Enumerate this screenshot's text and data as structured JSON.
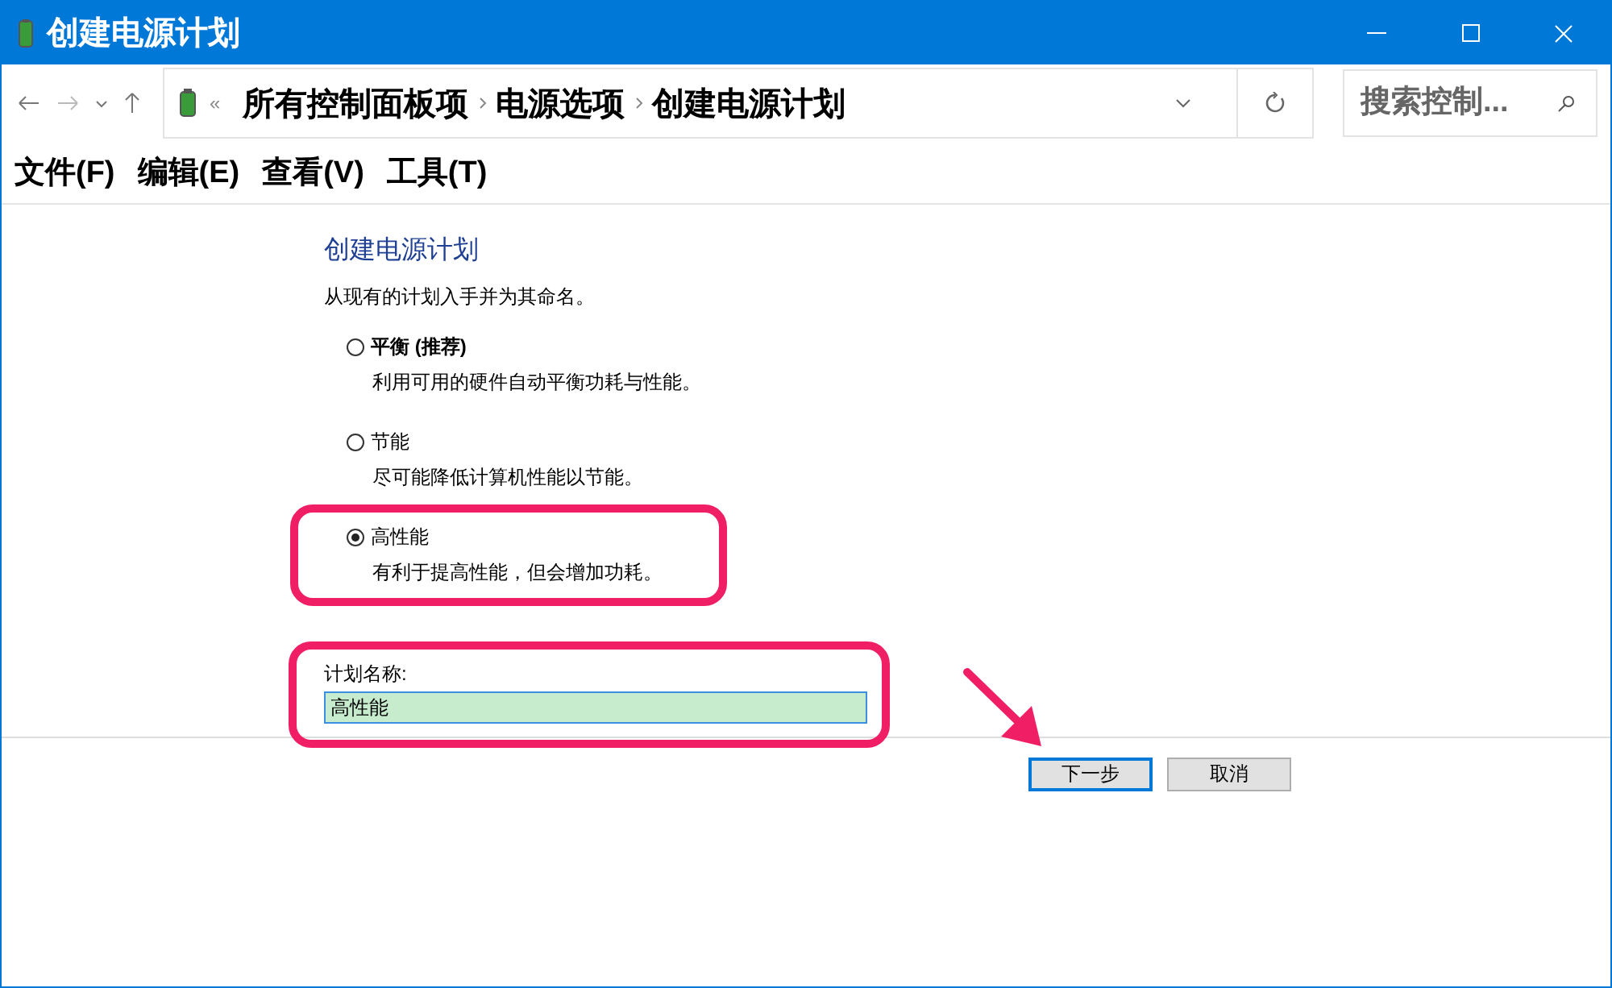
{
  "window": {
    "title": "创建电源计划"
  },
  "address_bar": {
    "overflow": "«",
    "path": [
      "所有控制面板项",
      "电源选项",
      "创建电源计划"
    ]
  },
  "search": {
    "placeholder": "搜索控制..."
  },
  "menu": [
    "文件(F)",
    "编辑(E)",
    "查看(V)",
    "工具(T)"
  ],
  "heading": "创建电源计划",
  "intro": "从现有的计划入手并为其命名。",
  "options": [
    {
      "label": "平衡 (推荐)",
      "description": "利用可用的硬件自动平衡功耗与性能。",
      "selected": false,
      "highlighted": false
    },
    {
      "label": "节能",
      "description": "尽可能降低计算机性能以节能。",
      "selected": false,
      "highlighted": false
    },
    {
      "label": "高性能",
      "description": "有利于提高性能，但会增加功耗。",
      "selected": true,
      "highlighted": true
    }
  ],
  "plan_name": {
    "label": "计划名称:",
    "value": "高性能",
    "highlighted": true
  },
  "buttons": [
    {
      "label": "下一步",
      "default": true
    },
    {
      "label": "取消",
      "default": false
    }
  ]
}
